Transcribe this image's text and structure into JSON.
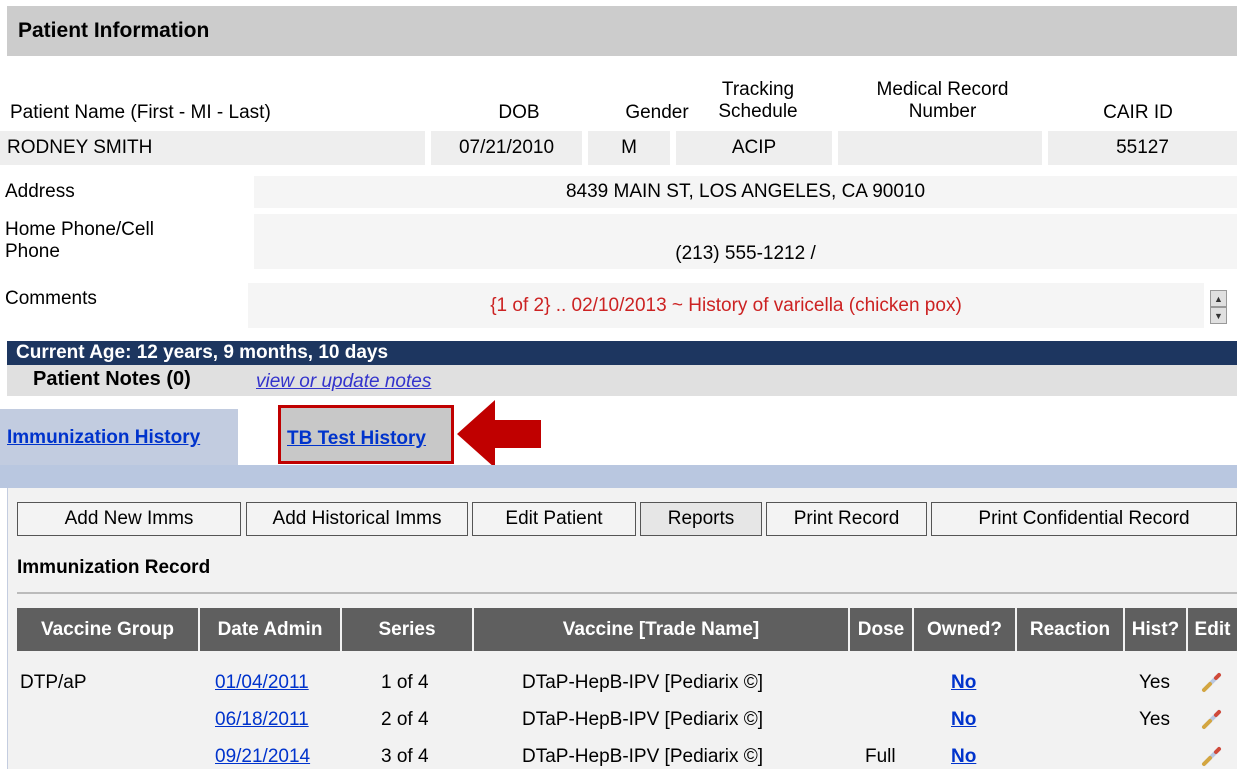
{
  "patient_info": {
    "title": "Patient Information",
    "headers": {
      "name": "Patient Name (First - MI - Last)",
      "dob": "DOB",
      "gender": "Gender",
      "tracking": "Tracking Schedule",
      "mrn": "Medical Record Number",
      "cair": "CAIR ID"
    },
    "values": {
      "name": "RODNEY SMITH",
      "dob": "07/21/2010",
      "gender": "M",
      "tracking": "ACIP",
      "mrn": "",
      "cair": "55127"
    },
    "address_label": "Address",
    "address": "8439 MAIN ST, LOS ANGELES, CA 90010",
    "phone_label": "Home Phone/Cell Phone",
    "phone": "(213) 555-1212 /",
    "comments_label": "Comments",
    "comments": "{1 of 2} .. 02/10/2013 ~ History of varicella (chicken pox)",
    "comments_color": "#cc2222"
  },
  "age_bar": "Current Age: 12 years, 9 months, 10 days",
  "notes": {
    "label": "Patient Notes (0)",
    "link": "view or update notes"
  },
  "tabs": {
    "immunization": "Immunization History",
    "tb": "TB Test History"
  },
  "buttons": {
    "add_new": "Add New Imms",
    "add_hist": "Add Historical Imms",
    "edit_patient": "Edit Patient",
    "reports": "Reports",
    "print": "Print Record",
    "print_conf": "Print Confidential Record"
  },
  "imm_record_title": "Immunization Record",
  "table": {
    "headers": [
      "Vaccine Group",
      "Date Admin",
      "Series",
      "Vaccine [Trade Name]",
      "Dose",
      "Owned?",
      "Reaction",
      "Hist?",
      "Edit"
    ],
    "rows": [
      {
        "group": "DTP/aP",
        "date": "01/04/2011",
        "series": "1 of 4",
        "vaccine": "DTaP-HepB-IPV [Pediarix ©]",
        "dose": "",
        "owned": "No",
        "reaction": "",
        "hist": "Yes"
      },
      {
        "group": "",
        "date": "06/18/2011",
        "series": "2 of 4",
        "vaccine": "DTaP-HepB-IPV [Pediarix ©]",
        "dose": "",
        "owned": "No",
        "reaction": "",
        "hist": "Yes"
      },
      {
        "group": "",
        "date": "09/21/2014",
        "series": "3 of 4",
        "vaccine": "DTaP-HepB-IPV [Pediarix ©]",
        "dose": "Full",
        "owned": "No",
        "reaction": "",
        "hist": ""
      }
    ]
  },
  "colors": {
    "age_bar": "#1d3660",
    "table_header": "#5f5f5f",
    "link": "#0033cc",
    "highlight": "#c00000"
  },
  "icons": [
    "edit-pencil-icon",
    "arrow-left-icon",
    "scroll-up-icon",
    "scroll-down-icon"
  ]
}
